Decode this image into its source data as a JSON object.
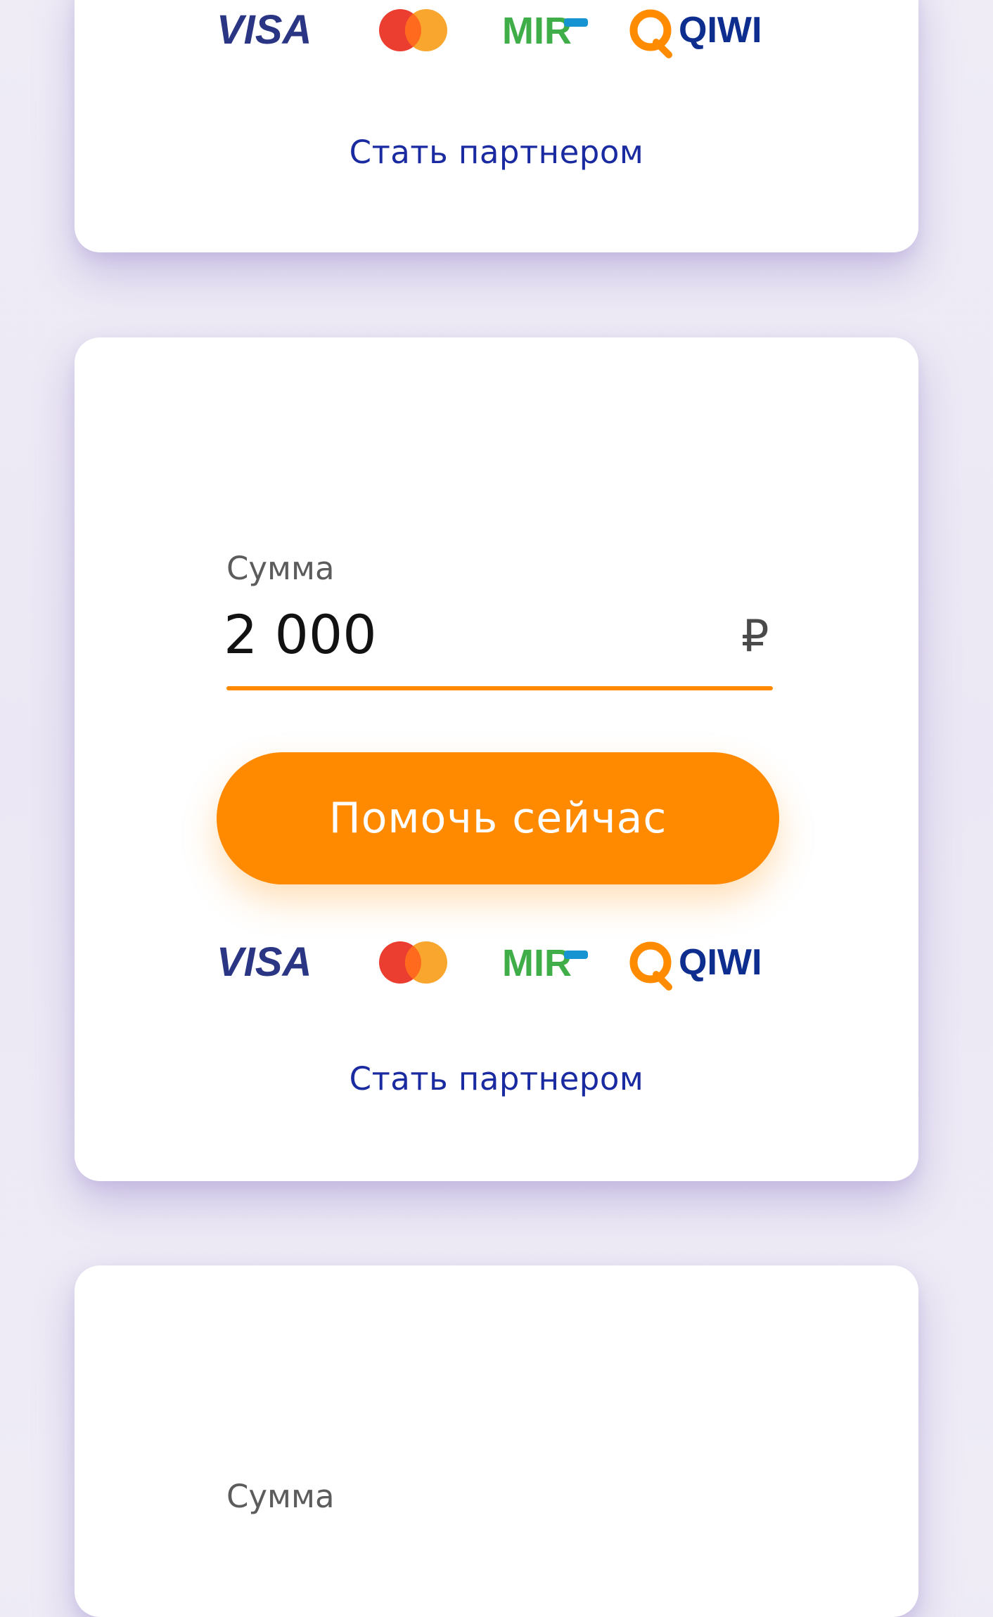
{
  "cards": [
    {
      "partner_link": "Стать партнером"
    },
    {
      "sum_label": "Сумма",
      "sum_value": "2 000",
      "currency": "₽",
      "button_label": "Помочь сейчас",
      "partner_link": "Стать партнером"
    },
    {
      "sum_label": "Сумма"
    }
  ],
  "payment_methods": {
    "visa": "VISA",
    "mastercard": "mastercard-icon",
    "mir": "MIR",
    "qiwi": "QIWI"
  },
  "colors": {
    "accent": "#ff8a00",
    "link": "#1a2aa0",
    "visa": "#2a3583",
    "mastercard_red": "#eb001b",
    "mastercard_orange": "#f79e1b",
    "mir_green": "#3fae49",
    "mir_blue": "#0f6bb5",
    "qiwi_orange": "#ff8c00",
    "qiwi_blue": "#0d2d8f"
  }
}
